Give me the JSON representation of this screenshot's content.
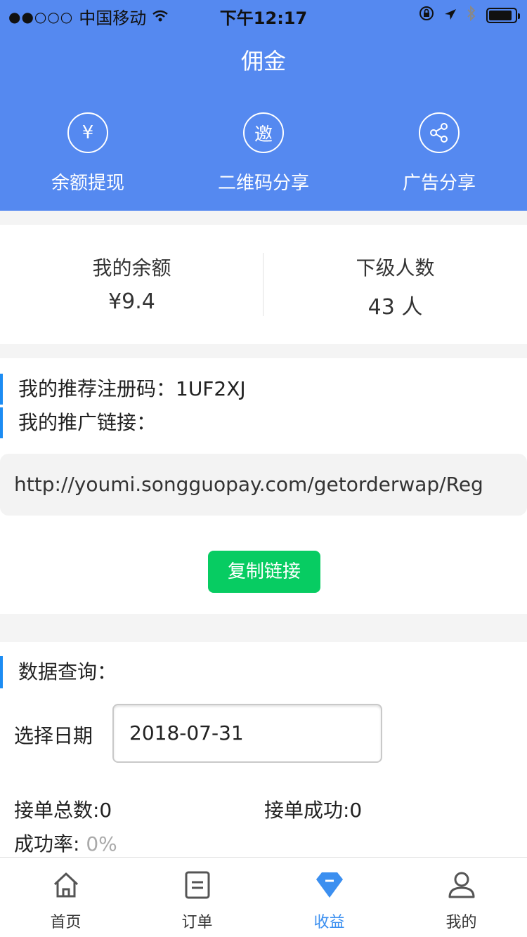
{
  "status_bar": {
    "carrier": "中国移动",
    "time": "下午12:17",
    "signal_icon": "signal-dots-icon",
    "wifi_icon": "wifi-icon",
    "battery_icon": "battery-icon"
  },
  "header": {
    "title": "佣金",
    "background_color": "#5589f0",
    "quick_actions": [
      {
        "icon": "yuan-icon",
        "glyph": "¥",
        "label": "余额提现"
      },
      {
        "icon": "invite-icon",
        "glyph": "邀",
        "label": "二维码分享"
      },
      {
        "icon": "share-icon",
        "glyph": "",
        "label": "广告分享"
      }
    ]
  },
  "stats": {
    "balance_title": "我的余额",
    "balance_value": "¥9.4",
    "members_title": "下级人数",
    "members_value": "43 人"
  },
  "promo": {
    "referral_code_line": "我的推荐注册码：1UF2XJ",
    "link_title": "我的推广链接：",
    "link_url": "http://youmi.songguopay.com/getorderwap/Reg",
    "copy_button": "复制链接",
    "accent_color": "#1c8cf3",
    "button_color": "#07cc62"
  },
  "query": {
    "title": "数据查询：",
    "date_label": "选择日期",
    "date_value": "2018-07-31",
    "total_orders": "接单总数:0",
    "success_orders": "接单成功:0",
    "success_rate_label": "成功率:",
    "success_rate_value": "0%"
  },
  "tabbar": {
    "active_color": "#3b8ff0",
    "tabs": [
      {
        "label": "首页",
        "icon": "home-icon"
      },
      {
        "label": "订单",
        "icon": "order-icon"
      },
      {
        "label": "收益",
        "icon": "earnings-icon",
        "active": true
      },
      {
        "label": "我的",
        "icon": "profile-icon"
      }
    ]
  }
}
